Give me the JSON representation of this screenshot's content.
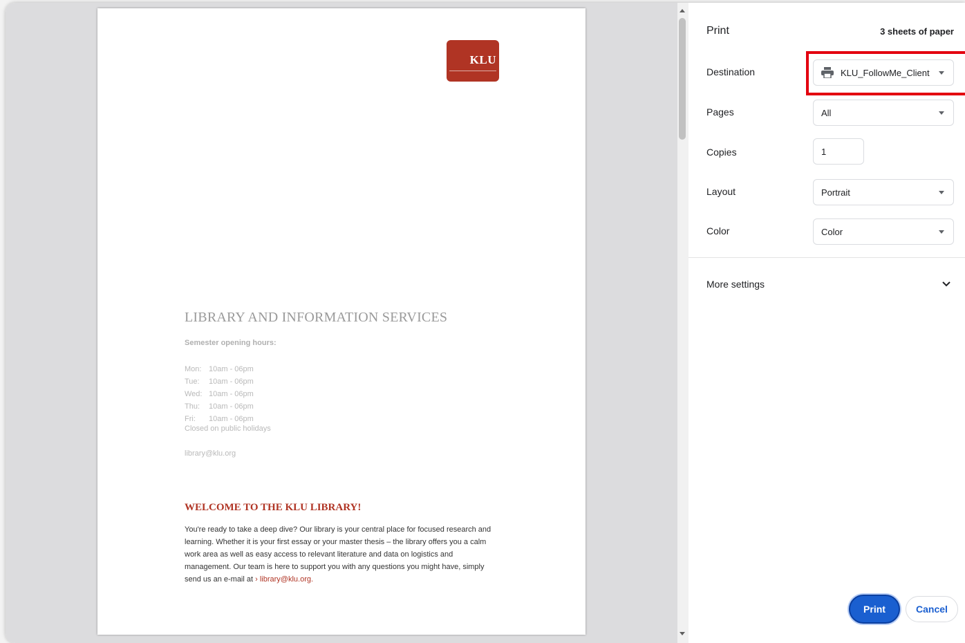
{
  "preview": {
    "logo_text": "KLU",
    "title": "LIBRARY AND INFORMATION SERVICES",
    "semester_label": "Semester opening hours:",
    "hours": [
      {
        "day": "Mon:",
        "time": "10am - 06pm"
      },
      {
        "day": "Tue:",
        "time": "10am - 06pm"
      },
      {
        "day": "Wed:",
        "time": "10am - 06pm"
      },
      {
        "day": "Thu:",
        "time": "10am - 06pm"
      },
      {
        "day": "Fri:",
        "time": "10am - 06pm"
      }
    ],
    "closed_note": "Closed on public holidays",
    "email": "library@klu.org",
    "welcome_title": "WELCOME TO THE KLU LIBRARY!",
    "welcome_body": "You're ready to take a deep dive? Our library is your central place for focused research and learning. Whether it is your first essay or your master thesis – the library offers you a calm work area as well as easy access to relevant literature and data on logistics and management. Our team is here to support you with any questions you might have, simply send us an e-mail at ",
    "welcome_link": "› library@klu.org",
    "welcome_end": "."
  },
  "panel": {
    "title": "Print",
    "sheets": "3 sheets of paper",
    "destination_label": "Destination",
    "destination_value": "KLU_FollowMe_Client",
    "pages_label": "Pages",
    "pages_value": "All",
    "copies_label": "Copies",
    "copies_value": "1",
    "layout_label": "Layout",
    "layout_value": "Portrait",
    "color_label": "Color",
    "color_value": "Color",
    "more_settings": "More settings",
    "print_button": "Print",
    "cancel_button": "Cancel"
  },
  "colors": {
    "brand_red": "#b03424",
    "highlight_red": "#e3000f",
    "accent_blue": "#1a5fd0"
  },
  "icons": {
    "destination": "printer-icon",
    "more": "chevron-down-icon"
  }
}
